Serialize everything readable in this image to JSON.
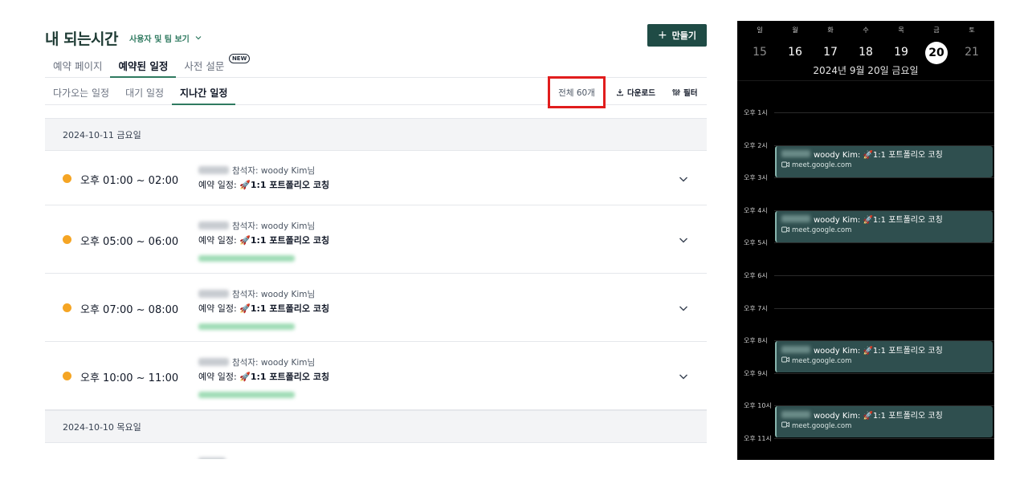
{
  "header": {
    "title": "내 되는시간",
    "user_team_label": "사용자 및 팀 보기",
    "create_button": "만들기"
  },
  "tabs": [
    {
      "label": "예약 페이지",
      "active": false
    },
    {
      "label": "예약된 일정",
      "active": true
    },
    {
      "label": "사전 설문",
      "active": false,
      "badge": "NEW"
    }
  ],
  "subtabs": [
    {
      "label": "다가오는 일정",
      "active": false
    },
    {
      "label": "대기 일정",
      "active": false
    },
    {
      "label": "지나간 일정",
      "active": true
    }
  ],
  "toolbar": {
    "count": "전체 60개",
    "download": "다운로드",
    "filter": "필터"
  },
  "groups": [
    {
      "date": "2024-10-11 금요일",
      "rows": [
        {
          "time": "오후 01:00 ~ 02:00",
          "participant": "참석자: woody Kim님",
          "event_prefix": "예약 일정: ",
          "event_name": "🚀1:1 포트폴리오 코칭",
          "has_extra": false
        },
        {
          "time": "오후 05:00 ~ 06:00",
          "participant": "참석자: woody Kim님",
          "event_prefix": "예약 일정: ",
          "event_name": "🚀1:1 포트폴리오 코칭",
          "has_extra": true
        },
        {
          "time": "오후 07:00 ~ 08:00",
          "participant": "참석자: woody Kim님",
          "event_prefix": "예약 일정: ",
          "event_name": "🚀1:1 포트폴리오 코칭",
          "has_extra": true
        },
        {
          "time": "오후 10:00 ~ 11:00",
          "participant": "참석자: woody Kim님",
          "event_prefix": "예약 일정: ",
          "event_name": "🚀1:1 포트폴리오 코칭",
          "has_extra": true
        }
      ]
    },
    {
      "date": "2024-10-10 목요일",
      "rows": []
    }
  ],
  "calendar": {
    "weekdays": [
      "일",
      "월",
      "화",
      "수",
      "목",
      "금",
      "토"
    ],
    "days": [
      "15",
      "16",
      "17",
      "18",
      "19",
      "20",
      "21"
    ],
    "selected_index": 5,
    "full_date": "2024년 9월 20일 금요일",
    "hours": [
      "오후 1시",
      "오후 2시",
      "오후 3시",
      "오후 4시",
      "오후 5시",
      "오후 6시",
      "오후 7시",
      "오후 8시",
      "오후 9시",
      "오후 10시",
      "오후 11시"
    ],
    "events": [
      {
        "title": "woody Kim: 🚀1:1 포트폴리오 코칭",
        "link": "meet.google.com",
        "start_hour_index": 1
      },
      {
        "title": "woody Kim: 🚀1:1 포트폴리오 코칭",
        "link": "meet.google.com",
        "start_hour_index": 3
      },
      {
        "title": "woody Kim: 🚀1:1 포트폴리오 코칭",
        "link": "meet.google.com",
        "start_hour_index": 7
      },
      {
        "title": "woody Kim: 🚀1:1 포트폴리오 코칭",
        "link": "meet.google.com",
        "start_hour_index": 9
      }
    ]
  },
  "colors": {
    "brand_dark": "#1f4b45",
    "accent_green": "#2f7a60",
    "status_dot": "#f5a524",
    "highlight_red": "#e11d1d",
    "event_bg": "#2f4f4f"
  }
}
